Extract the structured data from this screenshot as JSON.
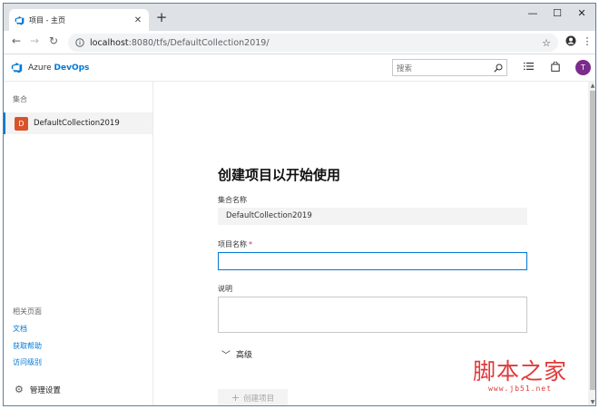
{
  "browser": {
    "tab_title": "项目 - 主页",
    "url_host": "localhost",
    "url_path": ":8080/tfs/DefaultCollection2019/"
  },
  "header": {
    "brand_prefix": "Azure ",
    "brand_name": "DevOps",
    "search_placeholder": "搜索",
    "avatar_initial": "T"
  },
  "sidebar": {
    "section_label": "集合",
    "collection_initial": "D",
    "collection_name": "DefaultCollection2019",
    "related_label": "相关页面",
    "links": [
      "文档",
      "获取帮助",
      "访问级别"
    ],
    "settings_label": "管理设置"
  },
  "form": {
    "title": "创建项目以开始使用",
    "collection_label": "集合名称",
    "collection_value": "DefaultCollection2019",
    "project_label": "项目名称",
    "required_mark": "*",
    "description_label": "说明",
    "advanced_label": "高级",
    "create_label": "创建项目"
  },
  "watermark": {
    "text": "脚本之家",
    "url": "www.jb51.net"
  },
  "colors": {
    "accent": "#0078d4",
    "collection_badge": "#d8532c",
    "avatar": "#7a2b8b"
  }
}
